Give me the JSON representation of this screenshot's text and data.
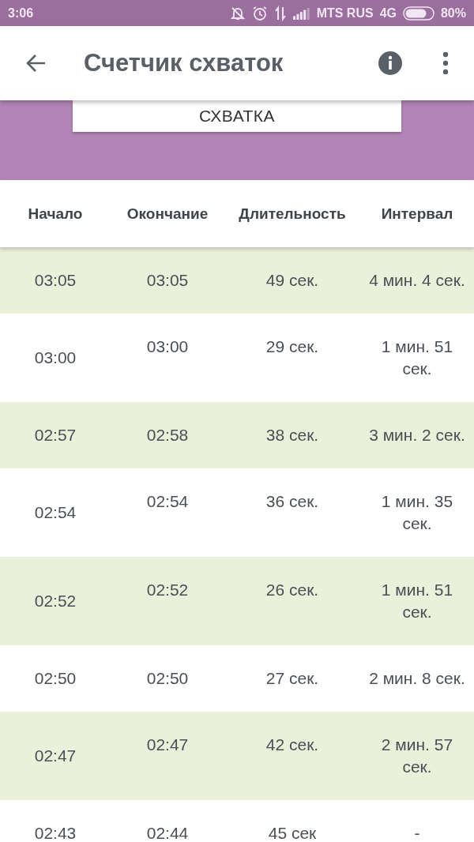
{
  "status_bar": {
    "time": "3:06",
    "carrier": "MTS RUS",
    "network": "4G",
    "battery": "80%"
  },
  "app_bar": {
    "title": "Счетчик схваток"
  },
  "action_button": {
    "label": "СХВАТКА"
  },
  "table": {
    "columns": [
      "Начало",
      "Окончание",
      "Длительность",
      "Интервал"
    ],
    "rows": [
      {
        "start": "03:05",
        "end": "03:05",
        "duration": "49 сек.",
        "interval": "4 мин. 4 сек."
      },
      {
        "start": "03:00",
        "end": "03:00",
        "duration": "29 сек.",
        "interval": "1 мин. 51 сек."
      },
      {
        "start": "02:57",
        "end": "02:58",
        "duration": "38 сек.",
        "interval": "3 мин. 2 сек."
      },
      {
        "start": "02:54",
        "end": "02:54",
        "duration": "36 сек.",
        "interval": "1 мин. 35 сек."
      },
      {
        "start": "02:52",
        "end": "02:52",
        "duration": "26 сек.",
        "interval": "1 мин. 51 сек."
      },
      {
        "start": "02:50",
        "end": "02:50",
        "duration": "27 сек.",
        "interval": "2 мин. 8 сек."
      },
      {
        "start": "02:47",
        "end": "02:47",
        "duration": "42 сек.",
        "interval": "2 мин. 57 сек."
      },
      {
        "start": "02:43",
        "end": "02:44",
        "duration": "45 сек",
        "interval": "-"
      }
    ]
  }
}
